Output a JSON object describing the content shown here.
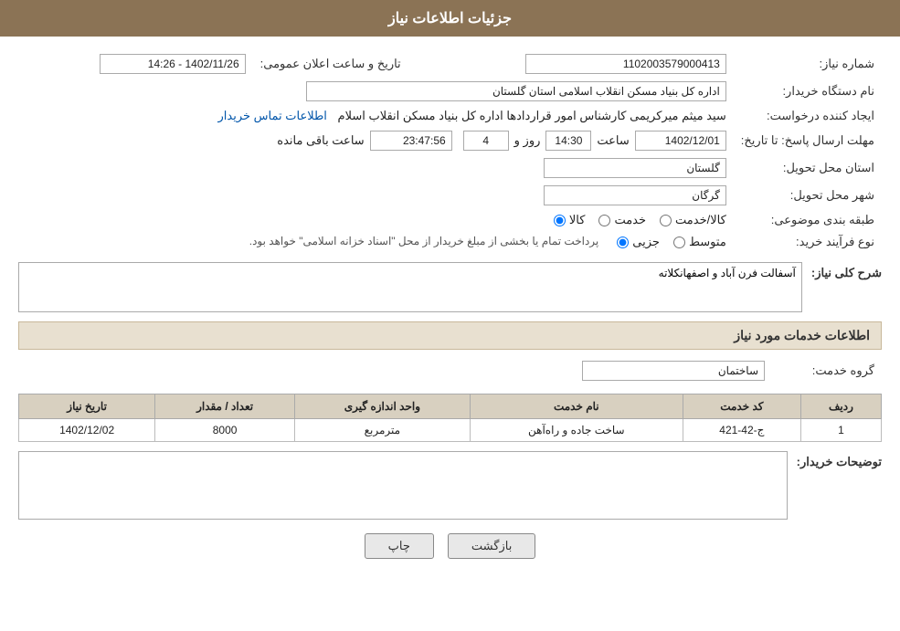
{
  "page": {
    "title": "جزئیات اطلاعات نیاز",
    "header_bg": "#8B7355"
  },
  "labels": {
    "need_number": "شماره نیاز:",
    "buyer_org": "نام دستگاه خریدار:",
    "requester": "ایجاد کننده درخواست:",
    "reply_deadline": "مهلت ارسال پاسخ: تا تاریخ:",
    "delivery_province": "استان محل تحویل:",
    "delivery_city": "شهر محل تحویل:",
    "subject_category": "طبقه بندی موضوعی:",
    "purchase_type": "نوع فرآیند خرید:",
    "need_description_title": "شرح کلی نیاز:",
    "services_title": "اطلاعات خدمات مورد نیاز",
    "service_group": "گروه خدمت:",
    "buyer_desc_title": "توضیحات خریدار:",
    "announce_datetime": "تاریخ و ساعت اعلان عمومی:",
    "remaining_time": "ساعت باقی مانده",
    "days": "روز و"
  },
  "values": {
    "need_number": "1102003579000413",
    "buyer_org": "اداره کل بنیاد مسکن انقلاب اسلامی استان گلستان",
    "requester_name": "سید میثم میرکریمی کارشناس امور قراردادها اداره کل بنیاد مسکن انقلاب اسلام",
    "contact_info_link": "اطلاعات تماس خریدار",
    "announce_date_value": "1402/11/26 - 14:26",
    "reply_date": "1402/12/01",
    "reply_time": "14:30",
    "days_count": "4",
    "remaining_time": "23:47:56",
    "delivery_province": "گلستان",
    "delivery_city": "گرگان",
    "subject_category_options": [
      {
        "label": "کالا",
        "value": "kala"
      },
      {
        "label": "خدمت",
        "value": "khedmat"
      },
      {
        "label": "کالا/خدمت",
        "value": "kala_khedmat"
      }
    ],
    "subject_selected": "kala",
    "purchase_type_options": [
      {
        "label": "جزیی",
        "value": "jozei"
      },
      {
        "label": "متوسط",
        "value": "motavaset"
      },
      {
        "label": "note",
        "value": "note"
      }
    ],
    "purchase_note": "پرداخت تمام یا بخشی از مبلغ خریدار از محل \"اسناد خزانه اسلامی\" خواهد بود.",
    "need_description": "آسفالت فرن آباد و اصفهانکلاته",
    "service_group_value": "ساختمان",
    "buyer_description": "",
    "table_headers": [
      "ردیف",
      "کد خدمت",
      "نام خدمت",
      "واحد اندازه گیری",
      "تعداد / مقدار",
      "تاریخ نیاز"
    ],
    "table_rows": [
      {
        "row": "1",
        "service_code": "ج-42-421",
        "service_name": "ساخت جاده و راه‌آهن",
        "unit": "مترمربع",
        "quantity": "8000",
        "date": "1402/12/02"
      }
    ],
    "buttons": {
      "print": "چاپ",
      "back": "بازگشت"
    },
    "col_label": "Col"
  }
}
